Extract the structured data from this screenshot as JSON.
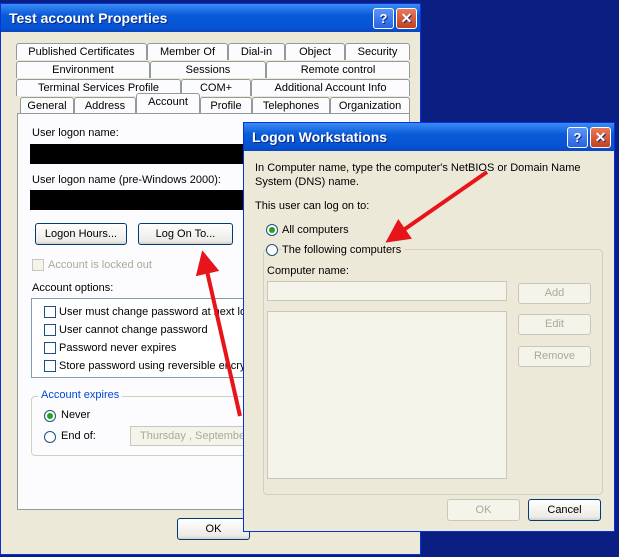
{
  "properties_window": {
    "title": "Test account Properties",
    "tabs_row1": [
      "Published Certificates",
      "Member Of",
      "Dial-in",
      "Object",
      "Security"
    ],
    "tabs_row2": [
      "Environment",
      "Sessions",
      "Remote control"
    ],
    "tabs_row3": [
      "Terminal Services Profile",
      "COM+",
      "Additional Account Info"
    ],
    "tabs_row4": [
      "General",
      "Address",
      "Account",
      "Profile",
      "Telephones",
      "Organization"
    ],
    "active_tab": "Account",
    "logon_name_label": "User logon name:",
    "logon_name_pre2000_label": "User logon name (pre-Windows 2000):",
    "logon_hours_button": "Logon Hours...",
    "log_on_to_button": "Log On To...",
    "locked_out_label": "Account is locked out",
    "account_options_label": "Account options:",
    "options": [
      "User must change password at next log",
      "User cannot change password",
      "Password never expires",
      "Store password using reversible encryp"
    ],
    "account_expires_label": "Account expires",
    "never_label": "Never",
    "end_of_label": "End of:",
    "end_of_date": "Thursday , September",
    "ok_button": "OK"
  },
  "logon_dialog": {
    "title": "Logon Workstations",
    "instruction": "In Computer name, type the computer's NetBIOS or Domain Name System (DNS) name.",
    "can_log_on_label": "This user can log on to:",
    "all_computers_label": "All computers",
    "following_computers_label": "The following computers",
    "computer_name_label": "Computer name:",
    "computer_name_value": "",
    "add_button": "Add",
    "edit_button": "Edit",
    "remove_button": "Remove",
    "ok_button": "OK",
    "cancel_button": "Cancel"
  },
  "colors": {
    "desktop": "#0b1f82",
    "titlebar": "#0653d3",
    "annotation_arrow": "#e8141c"
  },
  "icons": [
    "help-icon",
    "close-icon"
  ]
}
